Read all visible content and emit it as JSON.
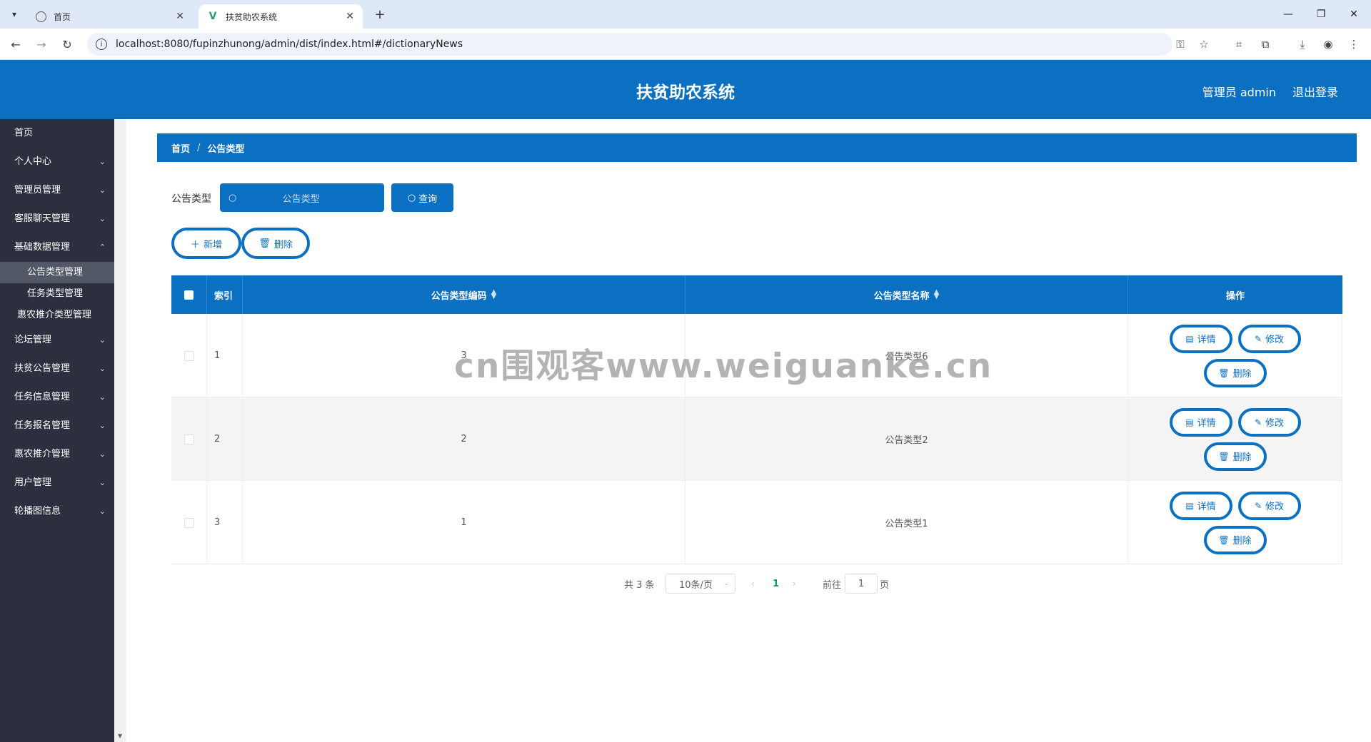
{
  "browser": {
    "tabs": [
      {
        "label": "首页",
        "favicon": "globe-icon"
      },
      {
        "label": "扶贫助农系统",
        "favicon": "vue-logo-icon"
      }
    ],
    "url": "localhost:8080/fupinzhunong/admin/dist/index.html#/dictionaryNews"
  },
  "header": {
    "title": "扶贫助农系统",
    "user": "管理员 admin",
    "logout": "退出登录"
  },
  "sidebar": {
    "items": [
      {
        "label": "首页"
      },
      {
        "label": "个人中心"
      },
      {
        "label": "管理员管理"
      },
      {
        "label": "客服聊天管理"
      },
      {
        "label": "基础数据管理"
      }
    ],
    "subitems": [
      {
        "label": "公告类型管理",
        "active": true
      },
      {
        "label": "任务类型管理"
      },
      {
        "label": "惠农推介类型管理"
      }
    ],
    "items2": [
      {
        "label": "论坛管理"
      },
      {
        "label": "扶贫公告管理"
      },
      {
        "label": "任务信息管理"
      },
      {
        "label": "任务报名管理"
      },
      {
        "label": "惠农推介管理"
      },
      {
        "label": "用户管理"
      },
      {
        "label": "轮播图信息"
      }
    ]
  },
  "breadcrumb": {
    "home": "首页",
    "sep": "/",
    "current": "公告类型"
  },
  "search": {
    "label": "公告类型",
    "placeholder": "公告类型",
    "button": "查询"
  },
  "actions": {
    "add": "新增",
    "delete": "删除"
  },
  "table": {
    "headers": {
      "index": "索引",
      "code": "公告类型编码",
      "name": "公告类型名称",
      "ops": "操作"
    },
    "rows": [
      {
        "index": "1",
        "code": "3",
        "name": "公告类型6"
      },
      {
        "index": "2",
        "code": "2",
        "name": "公告类型2"
      },
      {
        "index": "3",
        "code": "1",
        "name": "公告类型1"
      }
    ],
    "row_actions": {
      "detail": "详情",
      "edit": "修改",
      "delete": "删除"
    }
  },
  "pagination": {
    "total": "共 3 条",
    "page_size": "10条/页",
    "current": "1",
    "goto": "前往",
    "jump_value": "1",
    "page_suffix": "页"
  },
  "watermark": "cn围观客www.weiguanke.cn",
  "colors": {
    "primary": "#0b6fc2",
    "sidebar": "#2c2f3d",
    "sidebar_active": "#525866"
  }
}
